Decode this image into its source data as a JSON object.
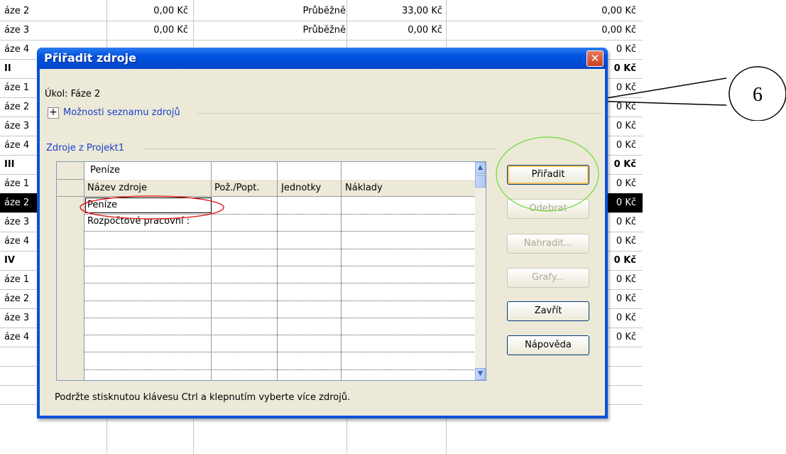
{
  "sheet": {
    "rows": [
      {
        "name": "áze 2",
        "v1": "0,00 Kč",
        "type": "Průběžně",
        "v2": "33,00 Kč",
        "v3": "0,00 Kč",
        "bold": false
      },
      {
        "name": "áze 3",
        "v1": "0,00 Kč",
        "type": "Průběžně",
        "v2": "0,00 Kč",
        "v3": "0,00 Kč",
        "bold": false
      },
      {
        "name": "áze 4",
        "v1": "",
        "type": "",
        "v2": "",
        "v3": "0 Kč",
        "bold": false
      },
      {
        "name": "II",
        "v1": "",
        "type": "",
        "v2": "",
        "v3": "0 Kč",
        "bold": true
      },
      {
        "name": "áze 1",
        "v1": "",
        "type": "",
        "v2": "",
        "v3": "0 Kč",
        "bold": false
      },
      {
        "name": "áze 2",
        "v1": "",
        "type": "",
        "v2": "",
        "v3": "0 Kč",
        "bold": false
      },
      {
        "name": "áze 3",
        "v1": "",
        "type": "",
        "v2": "",
        "v3": "0 Kč",
        "bold": false
      },
      {
        "name": "áze 4",
        "v1": "",
        "type": "",
        "v2": "",
        "v3": "0 Kč",
        "bold": false
      },
      {
        "name": "III",
        "v1": "",
        "type": "",
        "v2": "",
        "v3": "0 Kč",
        "bold": true
      },
      {
        "name": "áze 1",
        "v1": "",
        "type": "",
        "v2": "",
        "v3": "0 Kč",
        "bold": false
      },
      {
        "name": "áze 2",
        "v1": "",
        "type": "",
        "v2": "",
        "v3": "0 Kč",
        "bold": false,
        "selected": true
      },
      {
        "name": "áze 3",
        "v1": "",
        "type": "",
        "v2": "",
        "v3": "0 Kč",
        "bold": false
      },
      {
        "name": "áze 4",
        "v1": "",
        "type": "",
        "v2": "",
        "v3": "0 Kč",
        "bold": false
      },
      {
        "name": "IV",
        "v1": "",
        "type": "",
        "v2": "",
        "v3": "0 Kč",
        "bold": true
      },
      {
        "name": "áze 1",
        "v1": "",
        "type": "",
        "v2": "",
        "v3": "0 Kč",
        "bold": false
      },
      {
        "name": "áze 2",
        "v1": "",
        "type": "",
        "v2": "",
        "v3": "0 Kč",
        "bold": false
      },
      {
        "name": "áze 3",
        "v1": "",
        "type": "",
        "v2": "",
        "v3": "0 Kč",
        "bold": false
      },
      {
        "name": "áze 4",
        "v1": "",
        "type": "",
        "v2": "",
        "v3": "0 Kč",
        "bold": false
      },
      {
        "name": "",
        "v1": "",
        "type": "",
        "v2": "",
        "v3": "",
        "bold": false
      },
      {
        "name": "",
        "v1": "",
        "type": "",
        "v2": "",
        "v3": "",
        "bold": false
      },
      {
        "name": "",
        "v1": "",
        "type": "",
        "v2": "",
        "v3": "",
        "bold": false
      }
    ]
  },
  "callout": {
    "label": "6"
  },
  "dialog": {
    "title": "Přiřadit zdroje",
    "close_glyph": "✕",
    "task_label": "Úkol: Fáze 2",
    "options_toggle_glyph": "+",
    "options_label": "Možnosti seznamu zdrojů",
    "resources_group_label": "Zdroje z Projekt1",
    "grid": {
      "edit_value": "Peníze",
      "columns": [
        "Název zdroje",
        "Pož./Popt.",
        "Jednotky",
        "Náklady"
      ],
      "rows": [
        "Peníze",
        "Rozpočtové pracovní :",
        "",
        "",
        "",
        "",
        "",
        "",
        "",
        ""
      ]
    },
    "buttons": {
      "assign": "Přiřadit",
      "remove": "Odebrat",
      "replace": "Nahradit...",
      "graphs": "Grafy...",
      "close": "Zavřít",
      "help": "Nápověda"
    },
    "status_text": "Podržte stisknutou klávesu Ctrl a klepnutím vyberte více zdrojů.",
    "scroll_up_glyph": "▲",
    "scroll_down_glyph": "▼"
  },
  "colors": {
    "titlebar": "#0053e1",
    "dialog_face": "#ece9d8",
    "link_blue": "#1a3fc8",
    "highlight_red": "#e02020",
    "highlight_green": "#66dd33"
  }
}
